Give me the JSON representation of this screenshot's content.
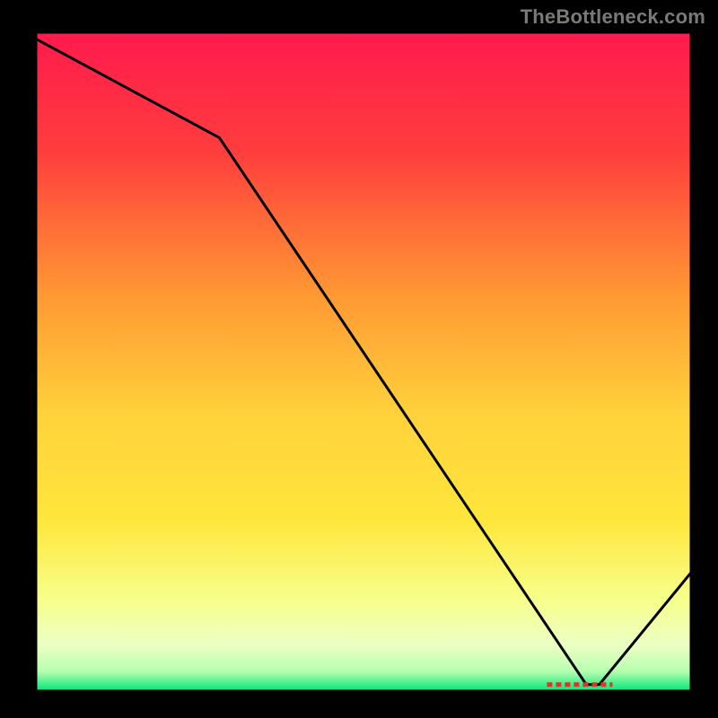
{
  "watermark": "TheBottleneck.com",
  "chart_data": {
    "type": "line",
    "title": "",
    "xlabel": "",
    "ylabel": "",
    "xlim": [
      0,
      100
    ],
    "ylim": [
      0,
      100
    ],
    "grid": false,
    "legend": false,
    "x": [
      0,
      28,
      84,
      86,
      100
    ],
    "values": [
      99,
      84,
      1,
      1,
      18
    ],
    "note": "Single black curve over a vertical heat gradient (red→orange→yellow→green). Minimum plateau near x≈84–86.",
    "marker_label": "",
    "marker_x_range": [
      78,
      88
    ],
    "colors": {
      "top": "#ff1a4d",
      "mid_upper": "#ff9933",
      "mid": "#ffe63b",
      "mid_lower": "#f7ff8a",
      "bottom": "#00e676",
      "curve": "#000000",
      "frame": "#000000"
    }
  }
}
